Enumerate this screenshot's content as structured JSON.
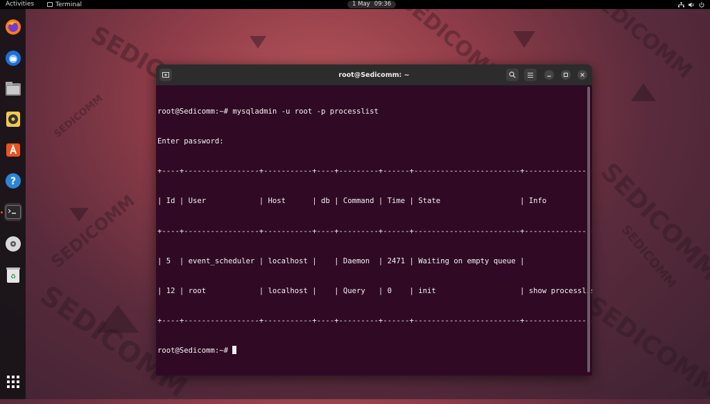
{
  "topbar": {
    "activities": "Activities",
    "app_name": "Terminal",
    "date": "1 May",
    "time": "09:36"
  },
  "dock": {
    "items": [
      {
        "name": "firefox-icon"
      },
      {
        "name": "thunderbird-icon"
      },
      {
        "name": "files-icon"
      },
      {
        "name": "rhythmbox-icon"
      },
      {
        "name": "software-icon"
      },
      {
        "name": "help-icon"
      },
      {
        "name": "terminal-icon"
      },
      {
        "name": "disc-icon"
      },
      {
        "name": "trash-icon"
      },
      {
        "name": "show-apps-icon"
      }
    ]
  },
  "wallpaper": {
    "watermark": "SEDICOMM"
  },
  "terminal": {
    "title": "root@Sedicomm: ~",
    "lines": [
      "root@Sedicomm:~# mysqladmin -u root -p processlist",
      "Enter password:",
      "+----+-----------------+-----------+----+---------+------+------------------------+------------------+",
      "| Id | User            | Host      | db | Command | Time | State                  | Info             |",
      "+----+-----------------+-----------+----+---------+------+------------------------+------------------+",
      "| 5  | event_scheduler | localhost |    | Daemon  | 2471 | Waiting on empty queue |                  |",
      "| 12 | root            | localhost |    | Query   | 0    | init                   | show processlist |",
      "+----+-----------------+-----------+----+---------+------+------------------------+------------------+"
    ],
    "prompt": "root@Sedicomm:~# "
  },
  "colors": {
    "terminal_bg": "#300a24",
    "header_bg": "#2c2c2c",
    "accent": "#e95420"
  }
}
